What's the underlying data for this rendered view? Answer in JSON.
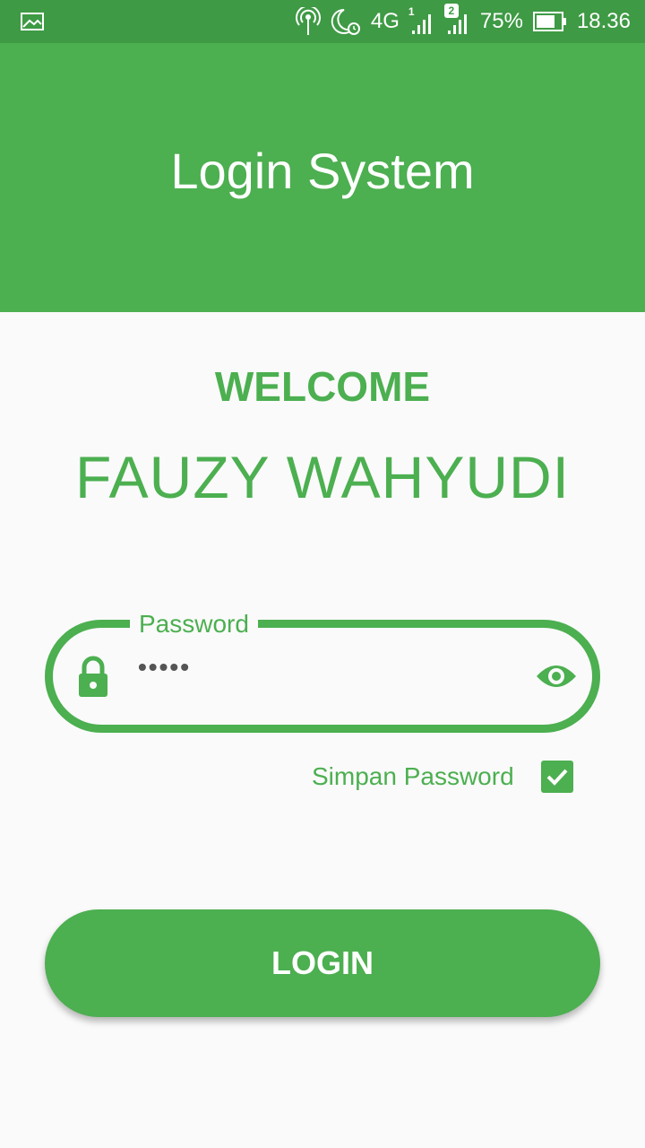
{
  "status_bar": {
    "network": "4G",
    "sim1_label": "1",
    "sim2_label": "2",
    "battery": "75%",
    "time": "18.36",
    "icons": [
      "image-icon",
      "hotspot-icon",
      "night-mode-icon",
      "alarm-icon",
      "signal-sim1-icon",
      "signal-sim2-icon",
      "battery-icon"
    ]
  },
  "app_bar": {
    "title": "Login System"
  },
  "main": {
    "welcome": "WELCOME",
    "username": "FAUZY WAHYUDI",
    "password_field": {
      "label": "Password",
      "value": "•••••"
    },
    "save_password": {
      "label": "Simpan Password",
      "checked": true
    },
    "login_button": "LOGIN"
  },
  "colors": {
    "primary": "#4caf50",
    "status_bar": "#3e9a44",
    "background": "#fafafa"
  }
}
